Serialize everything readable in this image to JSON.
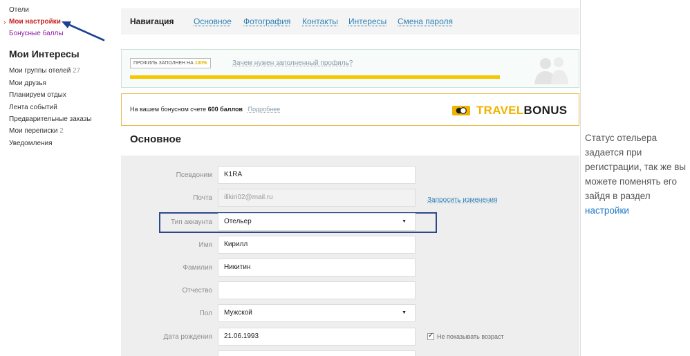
{
  "sidebar": {
    "links": [
      {
        "label": "Отели"
      },
      {
        "label": "Мои настройки",
        "active": true
      },
      {
        "label": "Бонусные баллы"
      }
    ],
    "marker": "›",
    "interests_heading": "Мои Интересы",
    "items": [
      {
        "label": "Мои группы отелей",
        "count": "27"
      },
      {
        "label": "Мои друзья",
        "count": ""
      },
      {
        "label": "Планируем отдых",
        "count": ""
      },
      {
        "label": "Лента событий",
        "count": ""
      },
      {
        "label": "Предварительные заказы",
        "count": ""
      },
      {
        "label": "Мои переписки",
        "count": "2"
      },
      {
        "label": "Уведомления",
        "count": ""
      }
    ]
  },
  "navigation": {
    "title": "Навигация",
    "tabs": [
      "Основное",
      "Фотография",
      "Контакты",
      "Интересы",
      "Смена пароля"
    ]
  },
  "profile": {
    "badge_prefix": "ПРОФИЛЬ ЗАПОЛНЕН НА",
    "badge_percent": "100%",
    "link": "Зачем нужен заполненный профиль?",
    "progress": 1.0
  },
  "bonus": {
    "text_before": "На вашем бонусном счете",
    "points": "600 баллов",
    "more": "Подробнее",
    "logo_travel": "TRAVEL",
    "logo_bonus": "BONUS"
  },
  "section_title": "Основное",
  "form": {
    "fields": [
      {
        "label": "Псевдоним",
        "value": "K1RA",
        "type": "text"
      },
      {
        "label": "Почта",
        "value": "illkiri02@mail.ru",
        "type": "disabled"
      },
      {
        "label": "Тип аккаунта",
        "value": "Отельер",
        "type": "select"
      },
      {
        "label": "Имя",
        "value": "Кирилл",
        "type": "text"
      },
      {
        "label": "Фамилия",
        "value": "Никитин",
        "type": "text"
      },
      {
        "label": "Отчество",
        "value": "",
        "type": "text"
      },
      {
        "label": "Пол",
        "value": "Мужской",
        "type": "select"
      },
      {
        "label": "Дата рождения",
        "value": "21.06.1993",
        "type": "text"
      },
      {
        "label": "",
        "value": "",
        "type": "text"
      }
    ],
    "request_change": "Запросить изменения",
    "hide_age": "Не показывать возраст",
    "hide_age_checked": true
  },
  "note": {
    "text": "Статус отельера задается при регистрации, так же вы можете поменять его зайдя в раздел ",
    "link": "настройки"
  },
  "colors": {
    "accent_link": "#2e7fb4",
    "active_link": "#c62020",
    "bonus_link": "#8a1da3",
    "progress": "#f5c800",
    "highlight_border": "#2a4a8c"
  }
}
